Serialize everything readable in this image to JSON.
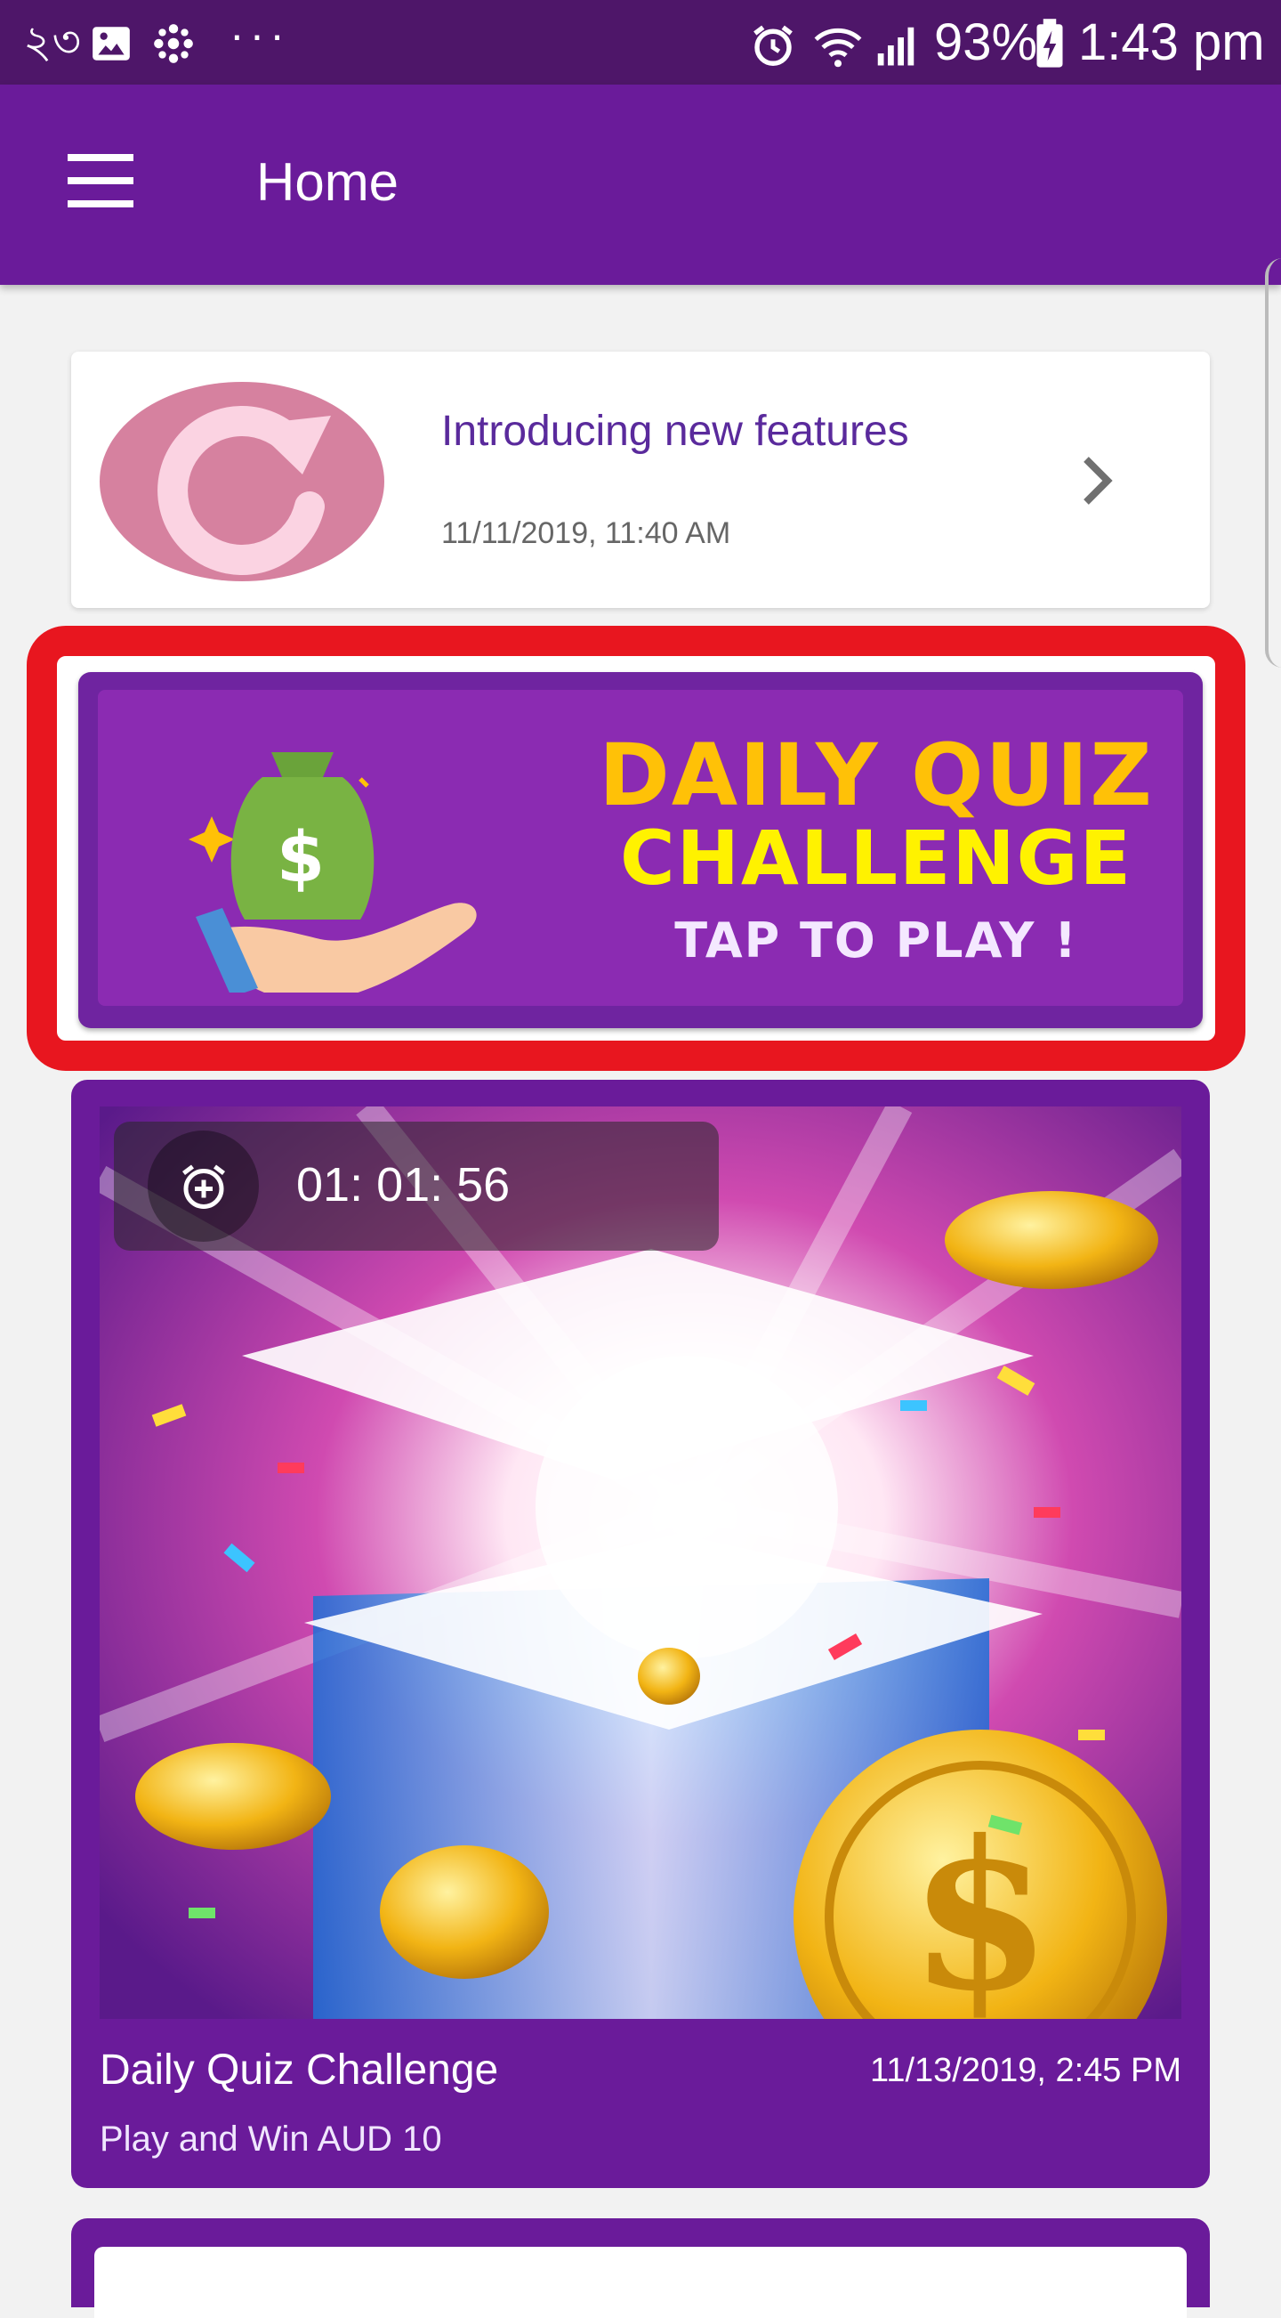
{
  "status_bar": {
    "left_text": "২৩",
    "more_dots": "···",
    "battery": "93%",
    "time": "1:43 pm"
  },
  "app_bar": {
    "title": "Home"
  },
  "notice": {
    "title": "Introducing new features",
    "date": "11/11/2019, 11:40 AM"
  },
  "banner": {
    "line1": "DAILY QUIZ",
    "line2": "CHALLENGE",
    "line3": "TAP TO PLAY !"
  },
  "prize_card": {
    "timer": "01: 01: 56",
    "title": "Daily Quiz Challenge",
    "date": "11/13/2019, 2:45 PM",
    "subtitle": "Play and Win AUD 10"
  },
  "colors": {
    "status_bar": "#4e1669",
    "primary": "#6a1b9a",
    "highlight": "#e8161f",
    "banner_yellow": "#ffc107"
  },
  "icons": [
    "image-icon",
    "snowflake-icon",
    "alarm-icon",
    "wifi-icon",
    "signal-icon",
    "battery-icon",
    "menu-icon",
    "refresh-icon",
    "chevron-right-icon",
    "money-bag-icon",
    "alarm-add-icon"
  ]
}
